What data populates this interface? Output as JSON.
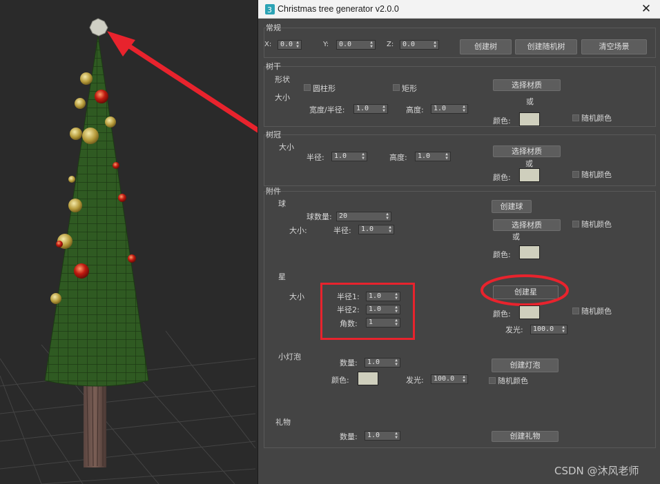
{
  "window": {
    "title": "Christmas tree generator v2.0.0",
    "close_glyph": "✕"
  },
  "general": {
    "group_label": "常规",
    "x_label": "X:",
    "x_value": "0.0",
    "y_label": "Y:",
    "y_value": "0.0",
    "z_label": "Z:",
    "z_value": "0.0",
    "create_tree": "创建树",
    "create_random_tree": "创建随机树",
    "clear_scene": "清空场景"
  },
  "trunk": {
    "group_label": "树干",
    "shape_label": "形状",
    "size_label": "大小",
    "cylinder_label": "圆柱形",
    "rect_label": "矩形",
    "width_label": "宽度/半径:",
    "width_value": "1.0",
    "height_label": "高度:",
    "height_value": "1.0",
    "select_material": "选择材质",
    "or_label": "或",
    "color_label": "颜色:",
    "random_color": "随机颜色"
  },
  "crown": {
    "group_label": "树冠",
    "size_label": "大小",
    "radius_label": "半径:",
    "radius_value": "1.0",
    "height_label": "高度:",
    "height_value": "1.0",
    "select_material": "选择材质",
    "or_label": "或",
    "color_label": "颜色:",
    "random_color": "随机颜色"
  },
  "accessories": {
    "group_label": "附件",
    "ball": {
      "label": "球",
      "count_label": "球数量:",
      "count_value": "20",
      "size_label": "大小:",
      "radius_label": "半径:",
      "radius_value": "1.0",
      "create": "创建球",
      "select_material": "选择材质",
      "random_color": "随机颜色",
      "or_label": "或",
      "color_label": "颜色:"
    },
    "star": {
      "label": "星",
      "size_label": "大小",
      "radius1_label": "半径1:",
      "radius1_value": "1.0",
      "radius2_label": "半径2:",
      "radius2_value": "1.0",
      "points_label": "角数:",
      "points_value": "1",
      "create": "创建星",
      "color_label": "颜色:",
      "random_color": "随机颜色",
      "glow_label": "发光:",
      "glow_value": "100.0"
    },
    "bulb": {
      "label": "小灯泡",
      "count_label": "数量:",
      "count_value": "1.0",
      "color_label": "颜色:",
      "glow_label": "发光:",
      "glow_value": "100.0",
      "create": "创建灯泡",
      "random_color": "随机颜色"
    },
    "gift": {
      "label": "礼物",
      "count_label": "数量:",
      "count_value": "1.0",
      "create": "创建礼物"
    }
  },
  "watermark": "CSDN @沐风老师",
  "colors": {
    "annotation_red": "#e8232d",
    "swatch": "#cfcfbd",
    "crown_green": "#3f6b2a",
    "trunk_brown": "#6a5148"
  }
}
